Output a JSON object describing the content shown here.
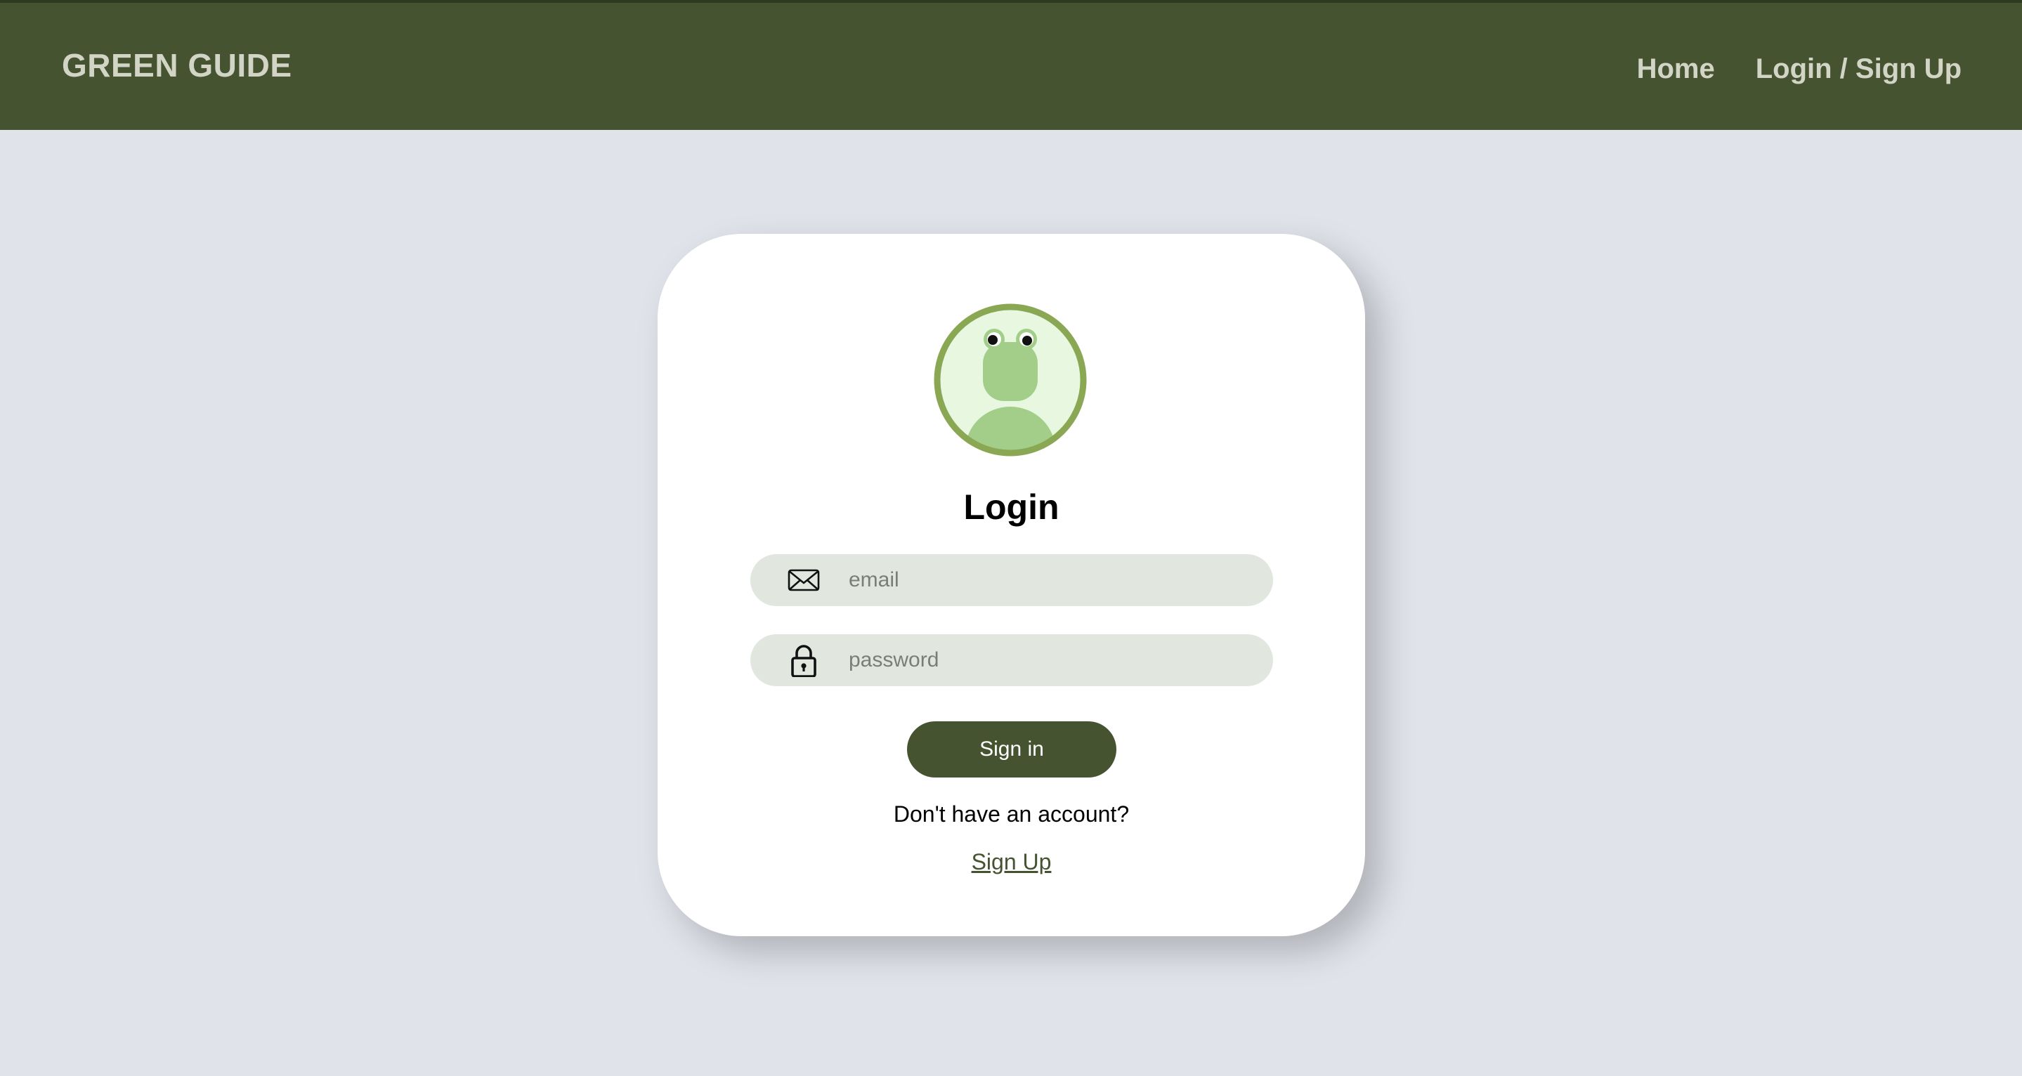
{
  "header": {
    "brand": "GREEN GUIDE",
    "nav": [
      {
        "label": "Home"
      },
      {
        "label": "Login / Sign Up"
      }
    ],
    "background_color": "#455330",
    "text_color": "#d2d4c6"
  },
  "login_card": {
    "avatar_icon": "frog-avatar-icon",
    "title": "Login",
    "email": {
      "icon": "envelope-icon",
      "placeholder": "email",
      "value": ""
    },
    "password": {
      "icon": "lock-icon",
      "placeholder": "password",
      "value": ""
    },
    "signin_label": "Sign in",
    "no_account_prompt": "Don't have an account?",
    "signup_link": "Sign Up"
  },
  "colors": {
    "accent": "#455330",
    "page_background": "#e0e3ea",
    "card_background": "#ffffff",
    "input_background": "#e1e6df",
    "avatar_ring": "#8aa853",
    "avatar_fill": "#e8f7df",
    "frog_green": "#a3ce8a"
  }
}
